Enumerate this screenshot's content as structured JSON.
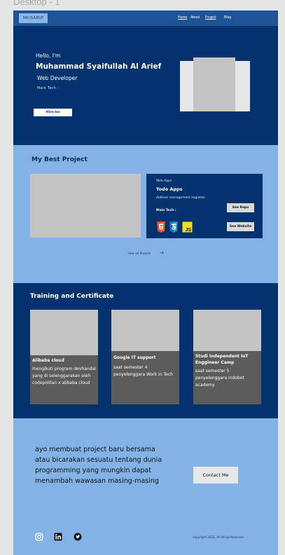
{
  "frame": {
    "label": "Desktop - 1"
  },
  "nav": {
    "logo": "MUSARIF",
    "links": [
      "Home",
      "About",
      "Project",
      "Blog"
    ]
  },
  "hero": {
    "greeting": "Hello, I'm",
    "name": "Muhammad Syaifullah Al Arief",
    "role": "Web Developer",
    "tech_label": "Main Tech :",
    "cta": "Hire me"
  },
  "projects": {
    "title": "My Best Project",
    "card": {
      "category": "Web Apps",
      "name": "Todo Apps",
      "description": "Aplikasi management kegiatan",
      "tech_label": "Main Tech :",
      "tech_icons": [
        "html5-icon",
        "css3-icon",
        "javascript-icon"
      ],
      "repo_button": "See Repo",
      "website_button": "See Website"
    },
    "see_all": "See all Project",
    "see_all_arrow": "→"
  },
  "certificates": {
    "title": "Training and Certificate",
    "items": [
      {
        "title": "Alibaba cloud",
        "description": "mengikuti program devhandal yang di selenggarakan oleh codepolitan x alibaba cloud"
      },
      {
        "title": "Google IT support",
        "description": "saat semester 4 penyelenggara Work in Tech"
      },
      {
        "title": "Studi Independent IoT Enggineer Camp",
        "description": "saat semester 5 penyelenggara indobot academy"
      }
    ]
  },
  "contact": {
    "text": "ayo membuat project baru bersama atau bicarakan sesuatu tentang dunia programming yang mungkin dapat menambah wawasan masing-masing",
    "button": "Contact Me"
  },
  "footer": {
    "socials": [
      "instagram-icon",
      "linkedin-icon",
      "twitter-icon"
    ],
    "copyright": "copyright 2021, All thing Reserved"
  },
  "colors": {
    "nav": "#1e5496",
    "dark": "#03326e",
    "light": "#83b3e6"
  }
}
